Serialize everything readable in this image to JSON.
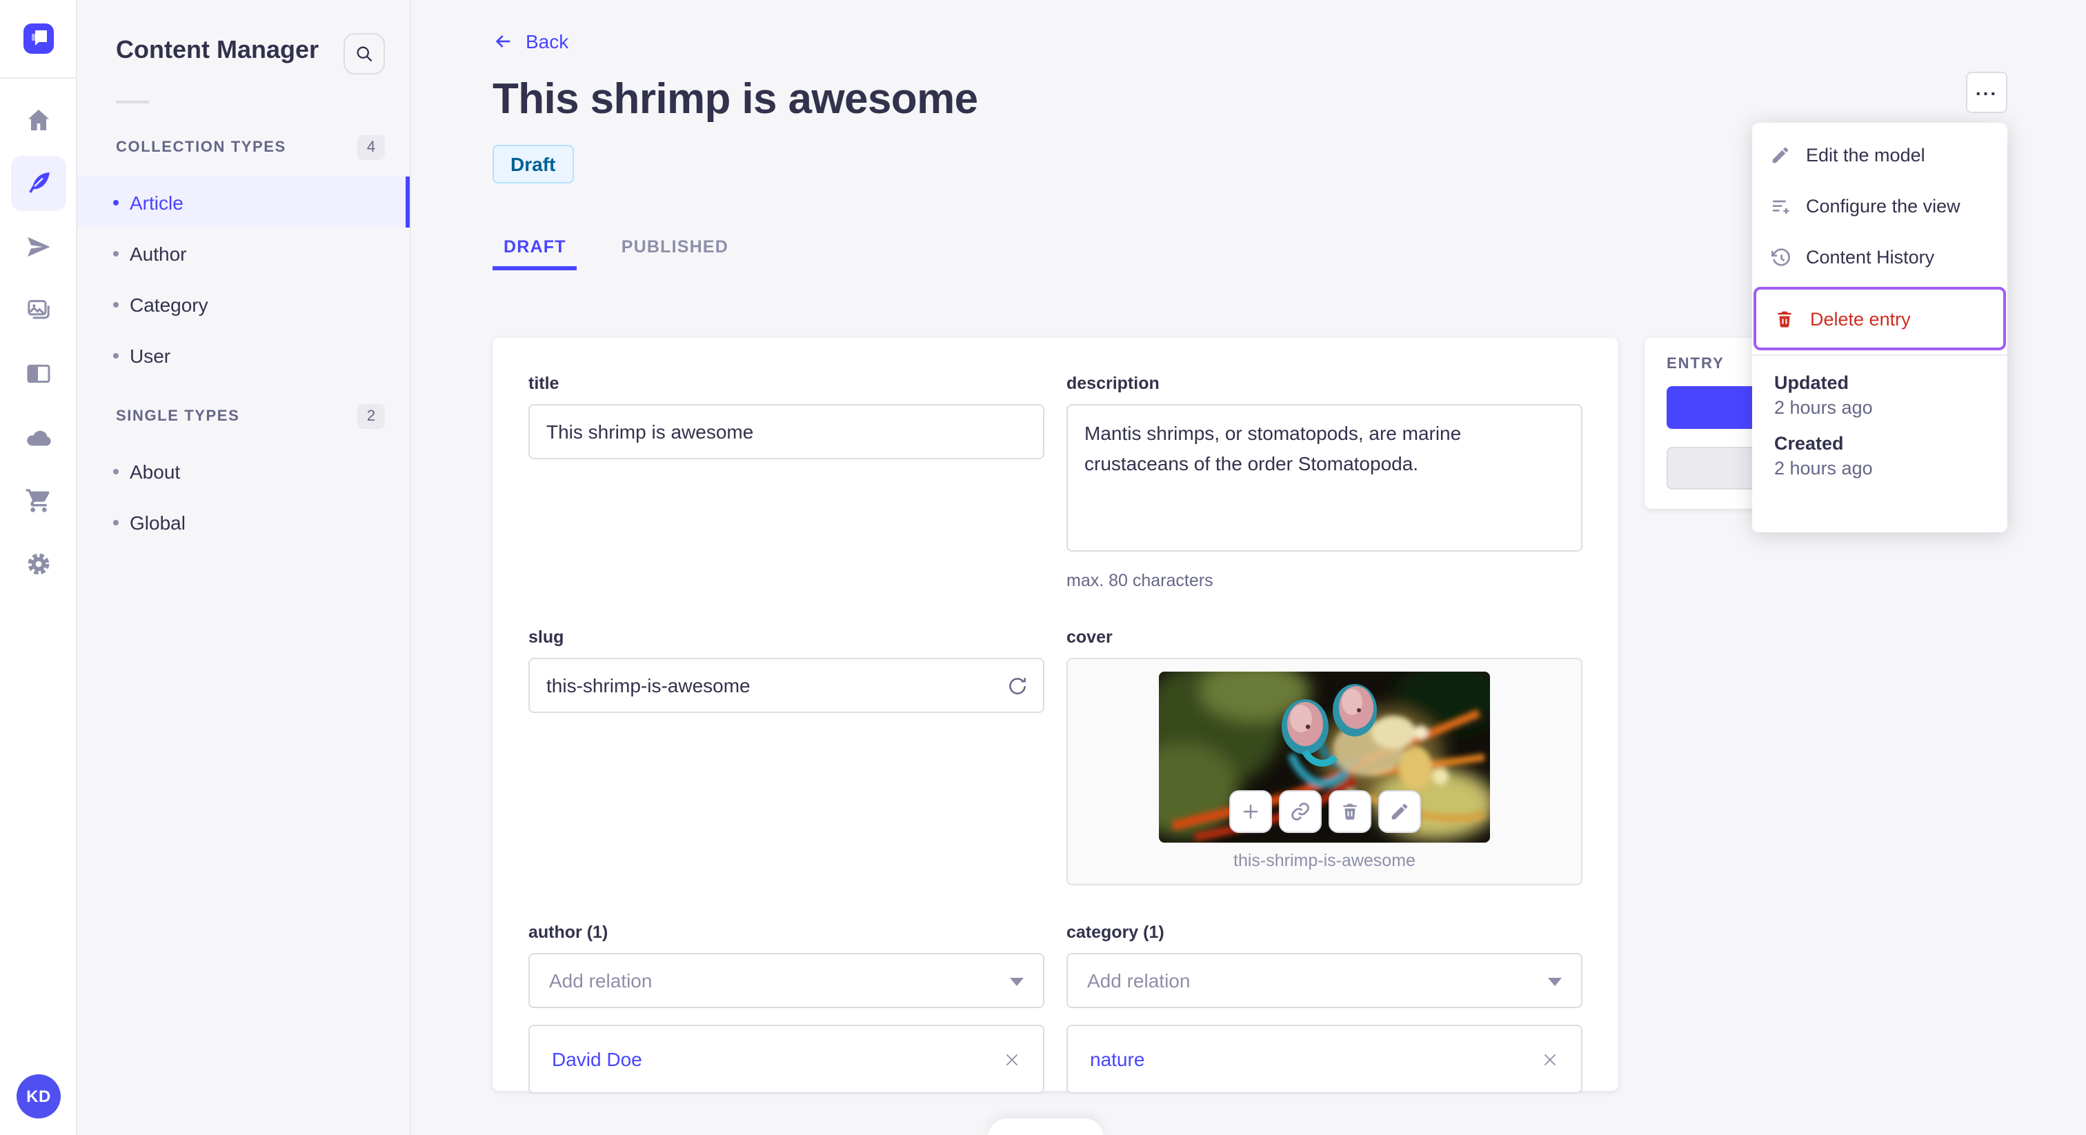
{
  "rail": {
    "avatar": "KD",
    "icons": [
      "strapi-logo",
      "home",
      "content-manager",
      "transfer",
      "media-library",
      "content-type-builder",
      "cloud",
      "marketplace",
      "settings"
    ]
  },
  "sidebar": {
    "title": "Content Manager",
    "sections": [
      {
        "label": "COLLECTION TYPES",
        "count": "4",
        "items": [
          {
            "label": "Article",
            "active": true
          },
          {
            "label": "Author"
          },
          {
            "label": "Category"
          },
          {
            "label": "User"
          }
        ]
      },
      {
        "label": "SINGLE TYPES",
        "count": "2",
        "items": [
          {
            "label": "About"
          },
          {
            "label": "Global"
          }
        ]
      }
    ]
  },
  "header": {
    "back_label": "Back",
    "title": "This shrimp is awesome",
    "status_badge": "Draft",
    "more_label": "...",
    "tabs": [
      {
        "label": "DRAFT",
        "active": true
      },
      {
        "label": "PUBLISHED"
      }
    ]
  },
  "form": {
    "title": {
      "label": "title",
      "value": "This shrimp is awesome"
    },
    "description": {
      "label": "description",
      "value": "Mantis shrimps, or stomatopods, are marine crustaceans of the order Stomatopoda.",
      "helper": "max. 80 characters"
    },
    "slug": {
      "label": "slug",
      "value": "this-shrimp-is-awesome"
    },
    "cover": {
      "label": "cover",
      "filename": "this-shrimp-is-awesome"
    },
    "author": {
      "label": "author (1)",
      "placeholder": "Add relation",
      "relations": [
        {
          "label": "David Doe"
        }
      ]
    },
    "category": {
      "label": "category (1)",
      "placeholder": "Add relation",
      "relations": [
        {
          "label": "nature"
        }
      ]
    }
  },
  "entry_panel": {
    "title": "ENTRY"
  },
  "context_menu": {
    "items": [
      {
        "label": "Edit the model"
      },
      {
        "label": "Configure the view"
      },
      {
        "label": "Content History"
      },
      {
        "label": "Delete entry",
        "danger": true,
        "highlighted": true
      }
    ],
    "meta": [
      {
        "label": "Updated",
        "value": "2 hours ago"
      },
      {
        "label": "Created",
        "value": "2 hours ago"
      }
    ]
  },
  "colors": {
    "accent": "#4945ff",
    "accent_light": "#f0f0ff",
    "danger": "#d02b20",
    "highlight_border": "#a25df2",
    "draft_bg": "#eaf5ff",
    "draft_border": "#b8e1ff",
    "draft_text": "#006096",
    "text": "#32324d",
    "text_muted": "#666687",
    "border": "#dcdce4",
    "page_bg": "#f6f6f9"
  }
}
